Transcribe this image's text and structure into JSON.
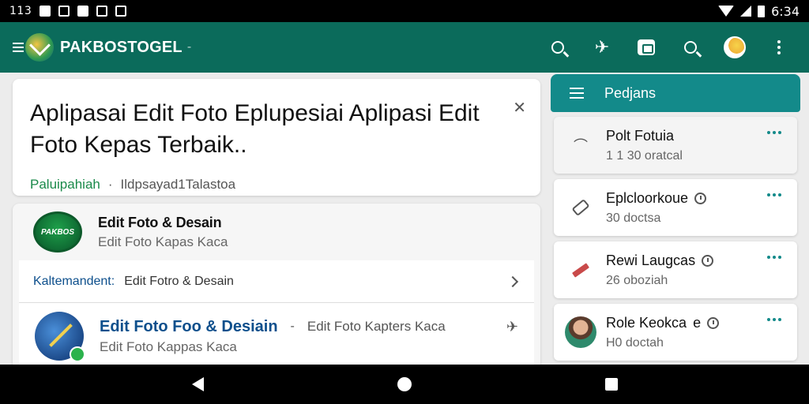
{
  "status_bar": {
    "left_time": "113",
    "clock": "6:34"
  },
  "app_bar": {
    "title": "PAKBOSTOGEL",
    "title_suffix": "-"
  },
  "main_card": {
    "title": "Aplipasai Edit Foto Eplupesiai Aplipasi Edit Foto Kepas Terbaik..",
    "meta_green": "Paluipahiah",
    "meta_sep": "·",
    "meta_text": "Ildpsayad1Talastoa",
    "close_glyph": "✕"
  },
  "list_card": {
    "app1": {
      "name": "Edit Foto & Desain",
      "sub": "Edit Foto Kapas Kaca",
      "logo_text": "PAKBOS"
    },
    "category": {
      "key": "Kaltemandent:",
      "value": "Edit Fotro & Desain"
    },
    "app2": {
      "name": "Edit Foto Foo & Desiain",
      "dash": "-",
      "extra": "Edit Foto Kapters Kaca",
      "sub": "Edit Foto Kappas Kaca"
    }
  },
  "side_panel": {
    "header": "Pedjans",
    "items": [
      {
        "title": "Polt Fotuia",
        "sub": "1 1 30 oratcal"
      },
      {
        "title": "Eplcloorkoue",
        "sub": "30 doctsa"
      },
      {
        "title": "Rewi Laugcas",
        "sub": "26 oboziah"
      },
      {
        "title": "Role Keokca",
        "title_extra": "e",
        "sub": "H0 doctah"
      }
    ]
  },
  "colors": {
    "app_bar": "#0b6b5b",
    "side_header": "#138a8a",
    "link_blue": "#0d4f8c",
    "green": "#1a8a4a"
  },
  "icons": {
    "app_bar": [
      "search-icon",
      "pin-icon",
      "chat-icon",
      "search-icon",
      "avatar",
      "more-vert-icon"
    ]
  }
}
